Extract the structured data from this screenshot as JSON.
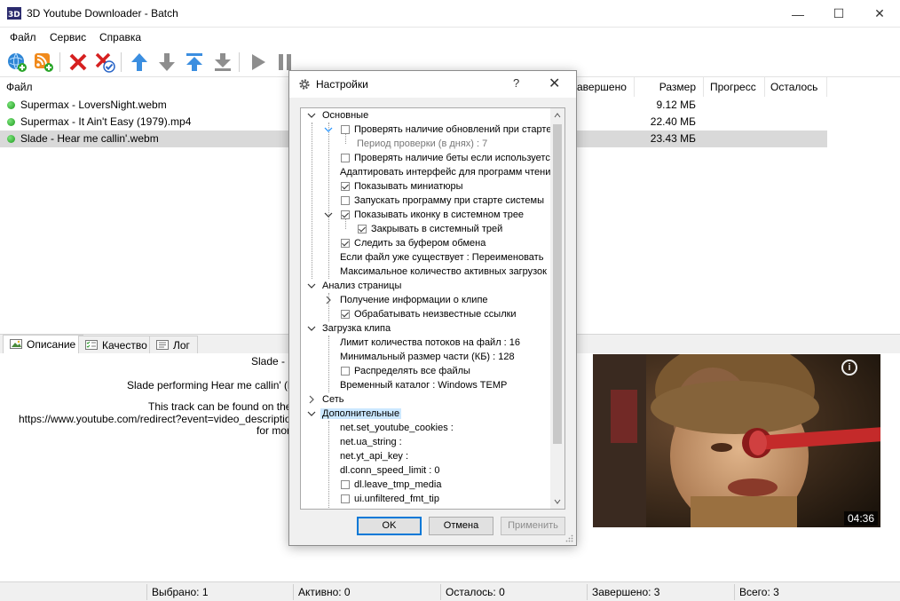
{
  "window": {
    "title": "3D Youtube Downloader - Batch",
    "minimize": "—",
    "maximize": "☐",
    "close": "✕"
  },
  "menu": [
    "Файл",
    "Сервис",
    "Справка"
  ],
  "toolbar": {
    "icons": [
      "add-link-icon",
      "add-rss-icon",
      "delete-icon",
      "delete-completed-icon",
      "move-top-icon",
      "move-down-icon",
      "move-up-icon",
      "move-bottom-icon",
      "start-icon",
      "pause-icon",
      "stop-icon"
    ]
  },
  "list": {
    "columns": [
      "Файл",
      "авершено",
      "Размер",
      "Прогресс",
      "Осталось"
    ],
    "rows": [
      {
        "name": "Supermax - LoversNight.webm",
        "size": "9.12 МБ"
      },
      {
        "name": "Supermax - It Ain't Easy (1979).mp4",
        "size": "22.40 МБ"
      },
      {
        "name": "Slade - Hear me callin'.webm",
        "size": "23.43 МБ"
      }
    ]
  },
  "tabs": [
    "Описание",
    "Качество",
    "Лог"
  ],
  "description": {
    "lines": [
      "Slade - H",
      "Slade performing Hear me callin' (by Alv",
      "This track can be found on the th",
      "https://www.youtube.com/redirect?event=video_description&redi",
      "for more"
    ]
  },
  "video": {
    "duration": "04:36",
    "info": "i"
  },
  "status": {
    "selected": "Выбрано: 1",
    "active": "Активно: 0",
    "remaining": "Осталось: 0",
    "completed": "Завершено: 3",
    "total": "Всего: 3"
  },
  "dialog": {
    "title": "Настройки",
    "help": "?",
    "close": "✕",
    "tree": [
      {
        "label": "Основные"
      },
      {
        "label": "Проверять наличие обновлений при старте"
      },
      {
        "label": "Период проверки (в днях) : 7"
      },
      {
        "label": "Проверять наличие беты если используетс"
      },
      {
        "label": "Адаптировать интерфейс для программ чтени"
      },
      {
        "label": "Показывать миниатюры"
      },
      {
        "label": "Запускать программу при старте системы"
      },
      {
        "label": "Показывать иконку в системном трее"
      },
      {
        "label": "Закрывать в системный трей"
      },
      {
        "label": "Следить за буфером обмена"
      },
      {
        "label": "Если файл уже существует : Переименовать"
      },
      {
        "label": "Максимальное количество активных загрузок"
      },
      {
        "label": "Анализ страницы"
      },
      {
        "label": "Получение информации о клипе"
      },
      {
        "label": "Обрабатывать неизвестные ссылки"
      },
      {
        "label": "Загрузка клипа"
      },
      {
        "label": "Лимит количества потоков на файл : 16"
      },
      {
        "label": "Минимальный размер части (КБ) : 128"
      },
      {
        "label": "Распределять все файлы"
      },
      {
        "label": "Временный каталог : Windows TEMP"
      },
      {
        "label": "Сеть"
      },
      {
        "label": "Дополнительные"
      },
      {
        "label": "net.set_youtube_cookies :"
      },
      {
        "label": "net.ua_string :"
      },
      {
        "label": "net.yt_api_key :"
      },
      {
        "label": "dl.conn_speed_limit : 0"
      },
      {
        "label": "dl.leave_tmp_media"
      },
      {
        "label": "ui.unfiltered_fmt_tip"
      }
    ],
    "buttons": {
      "ok": "OK",
      "cancel": "Отмена",
      "apply": "Применить"
    }
  }
}
